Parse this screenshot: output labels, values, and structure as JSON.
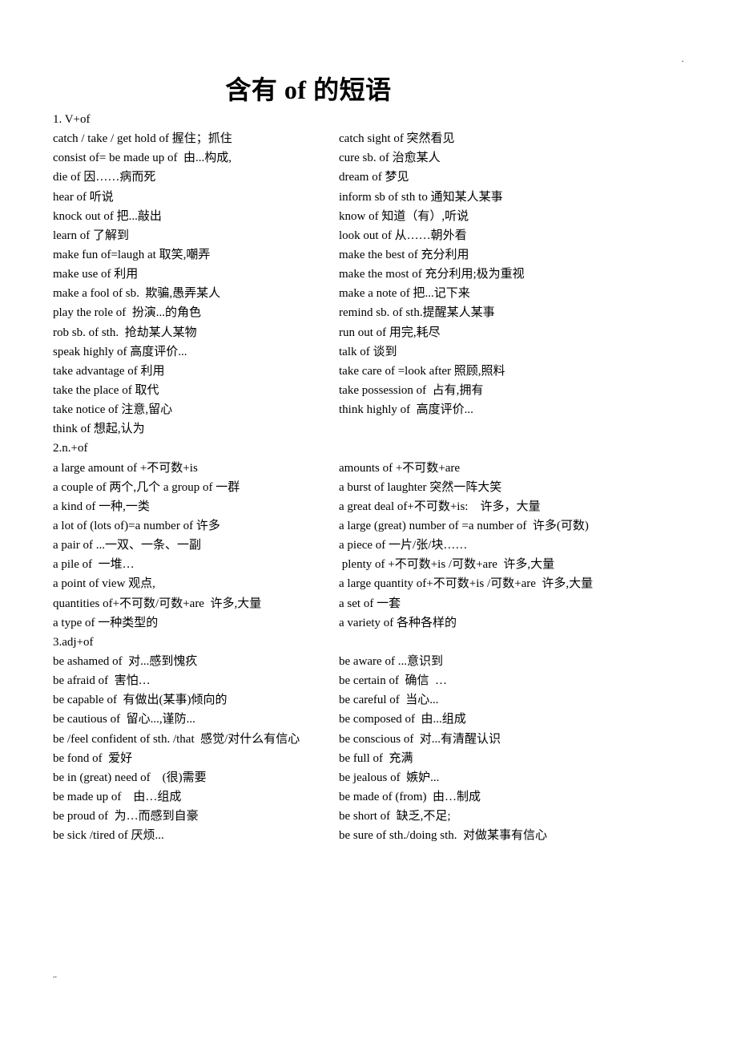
{
  "page": {
    "title": "含有 of 的短语",
    "corner_mark_top": ".",
    "corner_mark_bottom": ".."
  },
  "sections": [
    {
      "heading": "1. V+of",
      "rows": [
        [
          "catch / take / get hold of 握住；抓住",
          "catch sight of 突然看见"
        ],
        [
          "consist of= be made up of  由...构成,",
          "cure sb. of 治愈某人"
        ],
        [
          "die of 因……病而死",
          "dream of 梦见"
        ],
        [
          "hear of 听说",
          "inform sb of sth to 通知某人某事"
        ],
        [
          "knock out of 把...敲出",
          "know of 知道（有）,听说"
        ],
        [
          "learn of 了解到",
          "look out of 从……朝外看"
        ],
        [
          "make fun of=laugh at 取笑,嘲弄",
          "make the best of 充分利用"
        ],
        [
          "make use of 利用",
          "make the most of 充分利用;极为重视"
        ],
        [
          "make a fool of sb.  欺骗,愚弄某人",
          "make a note of 把...记下来"
        ],
        [
          "play the role of  扮演...的角色",
          "remind sb. of sth.提醒某人某事"
        ],
        [
          "rob sb. of sth.  抢劫某人某物",
          "run out of 用完,耗尽"
        ],
        [
          "speak highly of 高度评价...",
          "talk of 谈到"
        ],
        [
          "take advantage of 利用",
          "take care of =look after 照顾,照料"
        ],
        [
          "take the place of 取代",
          "take possession of  占有,拥有"
        ],
        [
          "take notice of 注意,留心",
          "think highly of  高度评价..."
        ],
        [
          "think of 想起,认为",
          ""
        ]
      ]
    },
    {
      "heading": "2.n.+of",
      "rows": [
        [
          "a large amount of +不可数+is",
          "amounts of +不可数+are"
        ],
        [
          "a couple of 两个,几个 a group of 一群",
          "a burst of laughter 突然一阵大笑"
        ],
        [
          "a kind of 一种,一类",
          "a great deal of+不可数+is:    许多，大量"
        ],
        [
          "a lot of (lots of)=a number of 许多",
          "a large (great) number of =a number of  许多(可数)"
        ],
        [
          "a pair of ...一双、一条、一副",
          "a piece of 一片/张/块……"
        ],
        [
          "a pile of  一堆…",
          " plenty of +不可数+is /可数+are  许多,大量"
        ],
        [
          "a point of view 观点,",
          "a large quantity of+不可数+is /可数+are  许多,大量"
        ],
        [
          "quantities of+不可数/可数+are  许多,大量",
          "a set of 一套"
        ],
        [
          "a type of 一种类型的",
          "a variety of 各种各样的"
        ]
      ]
    },
    {
      "heading": "3.adj+of",
      "rows": [
        [
          "be ashamed of  对...感到愧疚",
          "be aware of ...意识到"
        ],
        [
          "be afraid of  害怕…",
          "be certain of  确信  …"
        ],
        [
          "be capable of  有做出(某事)倾向的",
          "be careful of  当心..."
        ],
        [
          "be cautious of  留心...,谨防...",
          "be composed of  由...组成"
        ],
        [
          "be /feel confident of sth. /that  感觉/对什么有信心",
          "be conscious of  对...有清醒认识"
        ],
        [
          "be fond of  爱好",
          "be full of  充满"
        ],
        [
          "be in (great) need of    (很)需要",
          "be jealous of  嫉妒..."
        ],
        [
          "be made up of    由…组成",
          "be made of (from)  由…制成"
        ],
        [
          "be proud of  为…而感到自豪",
          "be short of  缺乏,不足;"
        ],
        [
          "be sick /tired of 厌烦...",
          "be sure of sth./doing sth.  对做某事有信心"
        ]
      ]
    }
  ]
}
